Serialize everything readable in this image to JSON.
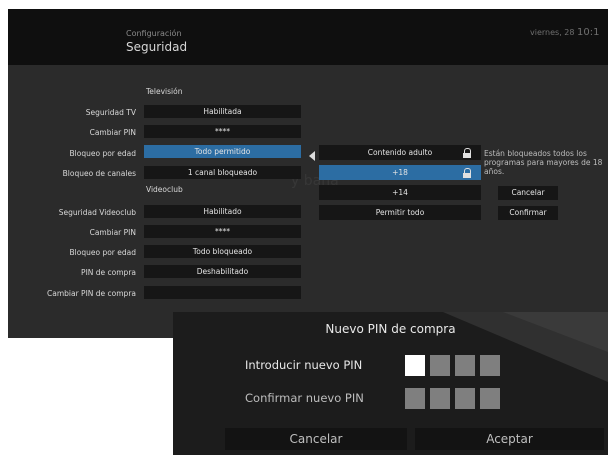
{
  "header": {
    "breadcrumb": "Configuración",
    "title": "Seguridad",
    "datetime": "viernes, 28",
    "time": "10:1"
  },
  "television": {
    "section_label": "Televisión",
    "rows": [
      {
        "label": "Seguridad TV",
        "value": "Habilitada"
      },
      {
        "label": "Cambiar PIN",
        "value": "****"
      },
      {
        "label": "Bloqueo por edad",
        "value": "Todo permitido"
      },
      {
        "label": "Bloqueo de canales",
        "value": "1 canal bloqueado"
      }
    ]
  },
  "videoclub": {
    "section_label": "Videoclub",
    "rows": [
      {
        "label": "Seguridad Videoclub",
        "value": "Habilitado"
      },
      {
        "label": "Cambiar PIN",
        "value": "****"
      },
      {
        "label": "Bloqueo por edad",
        "value": "Todo bloqueado"
      },
      {
        "label": "PIN de compra",
        "value": "Deshabilitado"
      },
      {
        "label": "Cambiar PIN de compra",
        "value": ""
      }
    ]
  },
  "age_popup": {
    "options": [
      {
        "label": "Contenido adulto",
        "locked": true,
        "selected": false
      },
      {
        "label": "+18",
        "locked": true,
        "selected": true
      },
      {
        "label": "+14",
        "locked": false,
        "selected": false
      },
      {
        "label": "Permitir todo",
        "locked": false,
        "selected": false
      }
    ],
    "info_text": "Están bloqueados todos los programas para mayores de 18 años.",
    "cancel_label": "Cancelar",
    "confirm_label": "Confirmar"
  },
  "pin_dialog": {
    "title": "Nuevo PIN de compra",
    "new_pin_label": "Introducir nuevo PIN",
    "confirm_pin_label": "Confirmar nuevo PIN",
    "cancel_label": "Cancelar",
    "accept_label": "Aceptar"
  },
  "colors": {
    "accent": "#2c6da3",
    "panel": "#2b2b2b",
    "field": "#161616"
  }
}
